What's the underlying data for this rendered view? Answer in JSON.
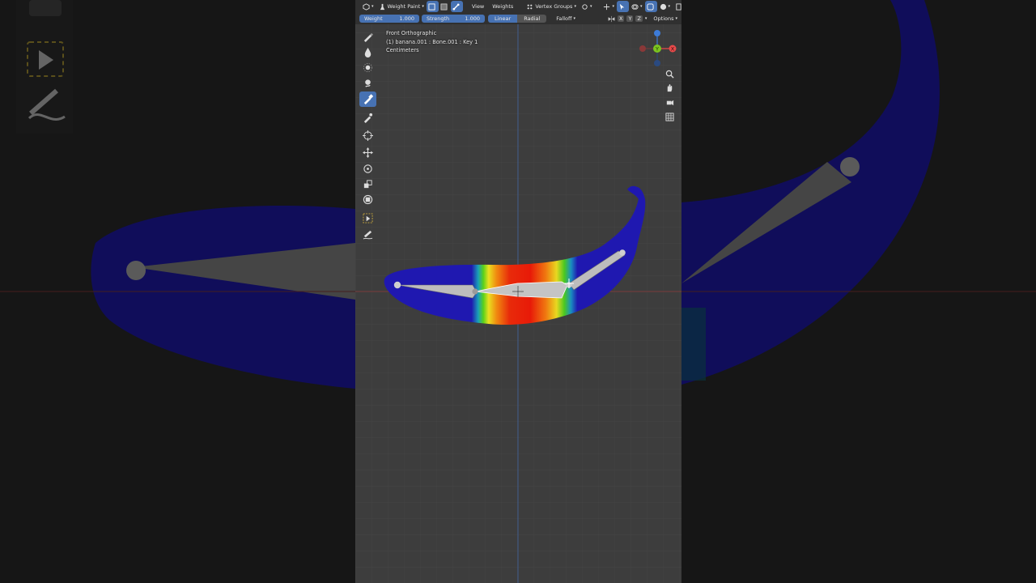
{
  "header": {
    "mode_label": "Weight Paint",
    "menu_view": "View",
    "menu_weights": "Weights",
    "vertex_groups_label": "Vertex Groups",
    "axis_x": "X",
    "axis_y": "Y",
    "axis_z": "Z",
    "options_label": "Options"
  },
  "tool_settings": {
    "weight_label": "Weight",
    "weight_value": "1.000",
    "strength_label": "Strength",
    "strength_value": "1.000",
    "falloff_shapes": [
      "Linear",
      "Radial"
    ],
    "falloff_shape_selected": "Linear",
    "falloff_label": "Falloff"
  },
  "viewport_info": {
    "view_name": "Front Orthographic",
    "object_line": "(1) banana.001 : Bone.001 : Key 1",
    "units": "Centimeters"
  },
  "toolbar": {
    "tools": [
      "draw-brush-icon",
      "blur-brush-icon",
      "average-brush-icon",
      "smear-brush-icon",
      "sample-weight-icon",
      "sample-group-icon",
      "cursor-icon",
      "move-icon",
      "rotate-icon",
      "scale-icon",
      "transform-icon",
      "select-box-icon",
      "annotate-icon"
    ],
    "active_tool": "sample-weight-icon"
  },
  "gizmo": {
    "axes": [
      "X",
      "Y",
      "Z"
    ],
    "colors": {
      "x": "#e84a4a",
      "y": "#7cc41f",
      "z": "#3d7cd9"
    }
  },
  "colors": {
    "accent": "#4772b3",
    "header_bg": "#303030",
    "viewport_bg": "#3d3d3d",
    "mesh_zero_weight": "#1f18b0"
  }
}
